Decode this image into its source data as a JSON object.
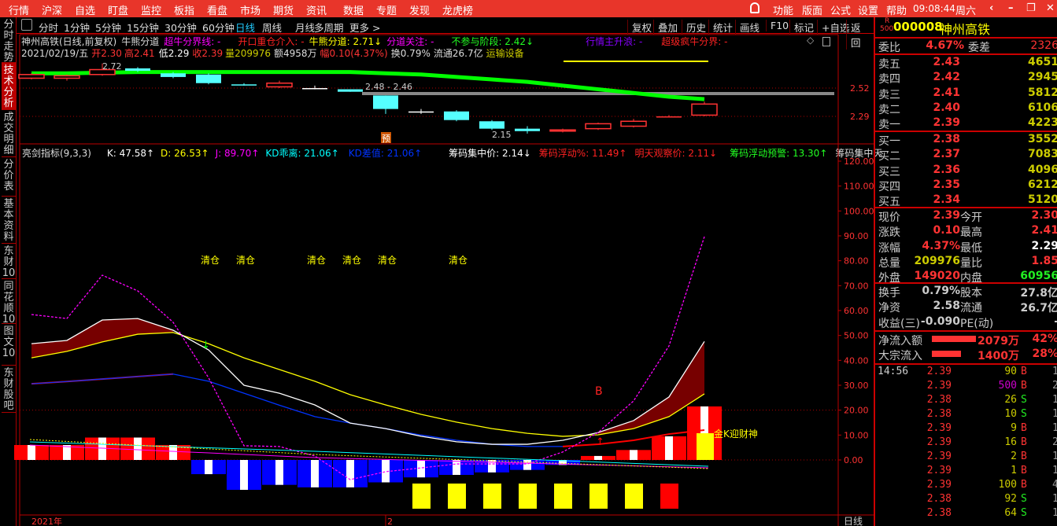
{
  "top_menu": [
    "行情",
    "沪深",
    "自选",
    "盯盘",
    "监控",
    "板指",
    "看盘",
    "市场",
    "期货",
    "资讯",
    "数据",
    "专题",
    "发现",
    "龙虎榜"
  ],
  "top_right": {
    "items": [
      "功能",
      "版面",
      "公式",
      "设置",
      "帮助"
    ],
    "time": "09:08:44",
    "weekday": "周六"
  },
  "sidebar": [
    "分时走势",
    "技术分析",
    "成交明细",
    "分价表",
    "基本资料",
    "东财10",
    "同花顺10",
    "图文10",
    "东财股吧"
  ],
  "periods": [
    "分时",
    "1分钟",
    "5分钟",
    "15分钟",
    "30分钟",
    "60分钟",
    "日线",
    "周线",
    "月线",
    "多周期",
    "更多 >"
  ],
  "active_period": "日线",
  "tool_buttons": [
    "复权",
    "叠加",
    "历史",
    "统计",
    "画线",
    "F10",
    "标记",
    "+自选",
    "返回"
  ],
  "info_row1": [
    {
      "t": "神州高铁(日线,前复权)",
      "c": "#ddd"
    },
    {
      "t": "牛熊分道",
      "c": "#ddd"
    },
    {
      "t": "超牛分界线: -",
      "c": "#f0f"
    },
    {
      "t": "开口重仓介入: -",
      "c": "#f22"
    },
    {
      "t": "牛熊分道: 2.71↓",
      "c": "#ff0"
    },
    {
      "t": "分道关注: -",
      "c": "#f0f"
    },
    {
      "t": "不参与阶段: 2.42↓",
      "c": "#2f2"
    },
    {
      "t": "行情主升浪: -",
      "c": "#80f"
    },
    {
      "t": "超级疯牛分界: -",
      "c": "#f22"
    }
  ],
  "info_row2": [
    {
      "t": "2021/02/19/五",
      "c": "#ddd"
    },
    {
      "t": "开2.30",
      "c": "#f33"
    },
    {
      "t": "高2.41",
      "c": "#f33"
    },
    {
      "t": "低2.29",
      "c": "#fff"
    },
    {
      "t": "收2.39",
      "c": "#f33"
    },
    {
      "t": "量209976",
      "c": "#cc0"
    },
    {
      "t": "额4958万",
      "c": "#ddd"
    },
    {
      "t": "幅0.10(4.37%)",
      "c": "#f33"
    },
    {
      "t": "换0.79%",
      "c": "#ddd"
    },
    {
      "t": "流通26.7亿",
      "c": "#ddd"
    },
    {
      "t": "运输设备",
      "c": "#cc0"
    }
  ],
  "indicator_row": [
    {
      "t": "亮剑指标(9,3,3)",
      "c": "#ddd"
    },
    {
      "t": "K: 47.58↑",
      "c": "#fff"
    },
    {
      "t": "D: 26.53↑",
      "c": "#ff0"
    },
    {
      "t": "J: 89.70↑",
      "c": "#f0f"
    },
    {
      "t": "KD乖离: 21.06↑",
      "c": "#0ff"
    },
    {
      "t": "KD差值: 21.06↑",
      "c": "#03f"
    },
    {
      "t": "筹码集中价: 2.14↓",
      "c": "#fff"
    },
    {
      "t": "筹码浮动%: 11.49↑",
      "c": "#f22"
    },
    {
      "t": "明天观察价: 2.11↓",
      "c": "#f22"
    },
    {
      "t": "筹码浮动预警: 13.30↑",
      "c": "#2f2"
    },
    {
      "t": "筹码集中天",
      "c": "#ddd"
    }
  ],
  "upper_chart": {
    "price_labels": [
      "2.52",
      "2.29"
    ],
    "high_label": "2.72",
    "low_label": "2.15",
    "range_label": "2.48 - 2.46",
    "flag": "预",
    "candles": [
      [
        2.6,
        2.63,
        2.64,
        2.59
      ],
      [
        2.6,
        2.62,
        2.63,
        2.58
      ],
      [
        2.63,
        2.67,
        2.72,
        2.62
      ],
      [
        2.68,
        2.66,
        2.69,
        2.65
      ],
      [
        2.64,
        2.61,
        2.65,
        2.6
      ],
      [
        2.63,
        2.56,
        2.64,
        2.55
      ],
      [
        2.55,
        2.55,
        2.56,
        2.54
      ],
      [
        2.53,
        2.56,
        2.58,
        2.52
      ],
      [
        2.52,
        2.52,
        2.54,
        2.51
      ],
      [
        2.51,
        2.49,
        2.51,
        2.49
      ],
      [
        2.46,
        2.35,
        2.46,
        2.31
      ],
      [
        2.33,
        2.33,
        2.35,
        2.31
      ],
      [
        2.33,
        2.26,
        2.34,
        2.25
      ],
      [
        2.25,
        2.19,
        2.26,
        2.18
      ],
      [
        2.19,
        2.17,
        2.21,
        2.15
      ],
      [
        2.17,
        2.18,
        2.19,
        2.16
      ],
      [
        2.19,
        2.23,
        2.24,
        2.18
      ],
      [
        2.21,
        2.25,
        2.27,
        2.2
      ],
      [
        2.29,
        2.29,
        2.3,
        2.29
      ],
      [
        2.3,
        2.39,
        2.41,
        2.29
      ]
    ],
    "ma": [
      2.64,
      2.64,
      2.645,
      2.65,
      2.65,
      2.65,
      2.65,
      2.65,
      2.65,
      2.65,
      2.64,
      2.63,
      2.61,
      2.59,
      2.57,
      2.54,
      2.51,
      2.48,
      2.45,
      2.43
    ]
  },
  "lower_chart": {
    "y_labels": [
      "120.00",
      "110.00",
      "100.00",
      "90.00",
      "80.00",
      "70.00",
      "60.00",
      "50.00",
      "40.00",
      "30.00",
      "20.00",
      "10.00",
      "0.00"
    ],
    "K": [
      46.7,
      48,
      56.2,
      56.8,
      52.1,
      44.2,
      30,
      26.8,
      22.1,
      14.8,
      12.6,
      9.5,
      7.3,
      6.3,
      6.3,
      7.9,
      11,
      15.8,
      25.3,
      47.58
    ],
    "D": [
      41,
      43.6,
      47.4,
      50.5,
      51.2,
      46.7,
      41,
      36.3,
      31.6,
      26.2,
      22.1,
      18.3,
      15.2,
      12.6,
      10.7,
      9.5,
      10.1,
      12.6,
      17.4,
      26.53
    ],
    "J": [
      58.4,
      56.8,
      74.2,
      67.9,
      55.3,
      33,
      5.7,
      5.4,
      1.6,
      -7.9,
      -4.7,
      -3.2,
      -1.6,
      -1.6,
      -1.6,
      3.2,
      11,
      23.7,
      45.8,
      89.7
    ],
    "line": [
      30.6,
      31.5,
      32.5,
      33.5,
      34.5,
      31.6,
      26.8,
      22,
      17.4,
      14.8,
      12.6,
      10,
      7.9,
      6.3,
      5.4,
      5.4,
      6.3,
      7.9,
      10.4,
      12
    ],
    "hist": [
      6,
      6,
      9,
      9,
      6,
      -5.7,
      -12,
      -10,
      -11,
      -11,
      -9,
      -7,
      -6,
      -5,
      -4,
      -2,
      1.6,
      4,
      9.5,
      21.5
    ],
    "signals": {
      "clear_label": "清仓",
      "clear_at": [
        5,
        6,
        8,
        9,
        10,
        12
      ],
      "buy_label": "B",
      "gold_label": "金K迎财神"
    },
    "bottom_bars": [
      "#ff0",
      "#ff0",
      "#ff0",
      "#ff0",
      "#ff0",
      "#ff0",
      "#ff0",
      "#f00"
    ]
  },
  "x_axis": {
    "year": "2021年",
    "month": "2",
    "period": "日线"
  },
  "quote": {
    "code_badge": "R",
    "badge_sub": "500",
    "code": "000008",
    "name": "神州高铁",
    "weibi": {
      "l1": "委比",
      "v1": "4.67%",
      "l2": "委差",
      "v2": "2326"
    },
    "asks": [
      {
        "l": "卖五",
        "p": "2.43",
        "v": "4651"
      },
      {
        "l": "卖四",
        "p": "2.42",
        "v": "2945"
      },
      {
        "l": "卖三",
        "p": "2.41",
        "v": "5812"
      },
      {
        "l": "卖二",
        "p": "2.40",
        "v": "6106"
      },
      {
        "l": "卖一",
        "p": "2.39",
        "v": "4223"
      }
    ],
    "bids": [
      {
        "l": "买一",
        "p": "2.38",
        "v": "3552"
      },
      {
        "l": "买二",
        "p": "2.37",
        "v": "7083"
      },
      {
        "l": "买三",
        "p": "2.36",
        "v": "4096"
      },
      {
        "l": "买四",
        "p": "2.35",
        "v": "6212"
      },
      {
        "l": "买五",
        "p": "2.34",
        "v": "5120"
      }
    ],
    "stats1": [
      {
        "l1": "现价",
        "v1": "2.39",
        "c1": "#f33",
        "l2": "今开",
        "v2": "2.30",
        "c2": "#f33"
      },
      {
        "l1": "涨跌",
        "v1": "0.10",
        "c1": "#f33",
        "l2": "最高",
        "v2": "2.41",
        "c2": "#f33"
      },
      {
        "l1": "涨幅",
        "v1": "4.37%",
        "c1": "#f33",
        "l2": "最低",
        "v2": "2.29",
        "c2": "#fff"
      },
      {
        "l1": "总量",
        "v1": "209976",
        "c1": "#cc0",
        "l2": "量比",
        "v2": "1.85",
        "c2": "#f33"
      },
      {
        "l1": "外盘",
        "v1": "149020",
        "c1": "#f33",
        "l2": "内盘",
        "v2": "60956",
        "c2": "#2e2"
      }
    ],
    "stats2": [
      {
        "l1": "换手",
        "v1": "0.79%",
        "c1": "#ccc",
        "l2": "股本",
        "v2": "27.8亿",
        "c2": "#ccc"
      },
      {
        "l1": "净资",
        "v1": "2.58",
        "c1": "#ccc",
        "l2": "流通",
        "v2": "26.7亿",
        "c2": "#ccc"
      },
      {
        "l1": "收益(三)",
        "v1": "-0.090",
        "c1": "#ccc",
        "l2": "PE(动)",
        "v2": "-",
        "c2": "#ccc"
      }
    ],
    "flows": [
      {
        "l": "净流入额",
        "v": "2079万",
        "pct": "42%",
        "bar": 42
      },
      {
        "l": "大宗流入",
        "v": "1400万",
        "pct": "28%",
        "bar": 28
      }
    ],
    "trades_time": "14:56",
    "trades": [
      [
        "2.39",
        "90",
        "B",
        "1"
      ],
      [
        "2.39",
        "500",
        "B",
        "2"
      ],
      [
        "2.38",
        "26",
        "S",
        "1"
      ],
      [
        "2.38",
        "10",
        "S",
        "1"
      ],
      [
        "2.39",
        "9",
        "B",
        "1"
      ],
      [
        "2.39",
        "16",
        "B",
        "2"
      ],
      [
        "2.39",
        "2",
        "B",
        "1"
      ],
      [
        "2.39",
        "1",
        "B",
        "1"
      ],
      [
        "2.39",
        "100",
        "B",
        "4"
      ],
      [
        "2.38",
        "92",
        "S",
        "1"
      ],
      [
        "2.38",
        "64",
        "S",
        "1"
      ]
    ]
  }
}
